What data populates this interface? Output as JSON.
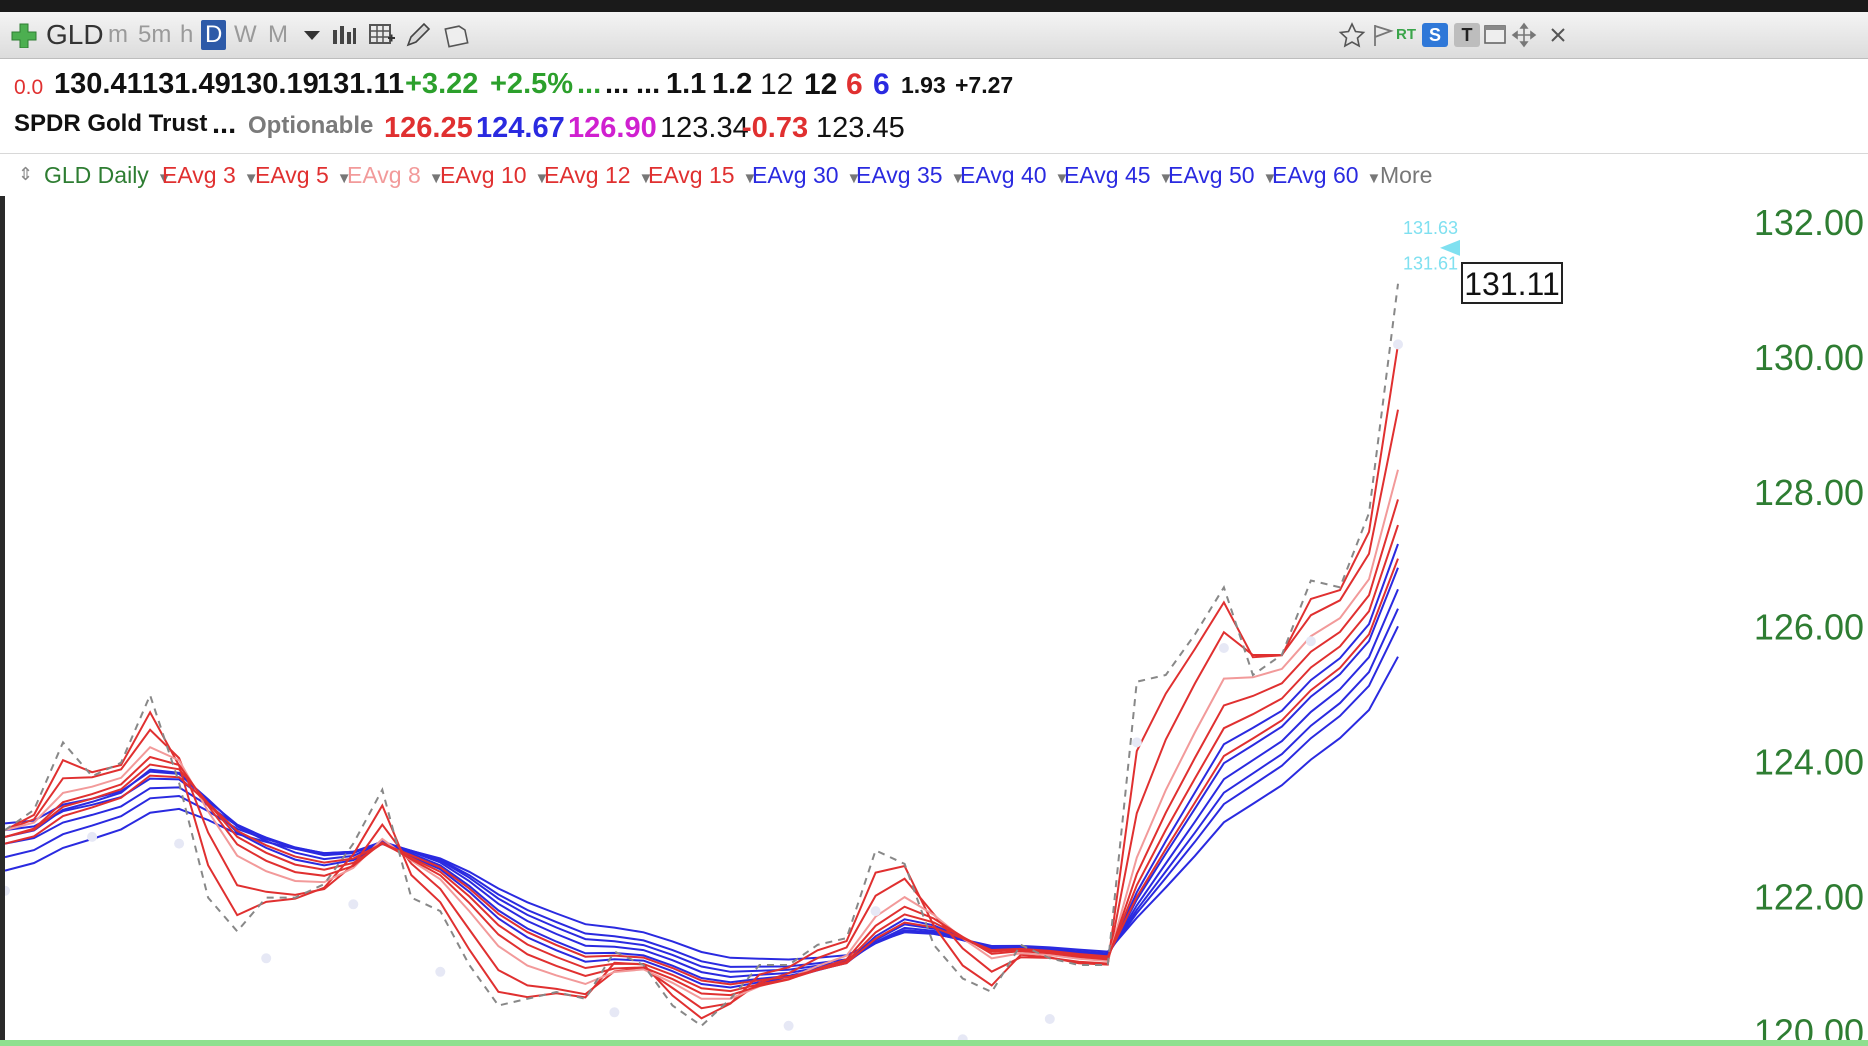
{
  "toolbar": {
    "symbol": "GLD",
    "periods": [
      "m",
      "5m",
      "h",
      "D",
      "W",
      "M"
    ],
    "selected_period": "D",
    "rt_label": "RT",
    "s_label": "S",
    "t_label": "T"
  },
  "quote": {
    "change_small": "0.0",
    "open": "130.41",
    "high": "131.49",
    "low": "130.19",
    "close": "131.11",
    "change": "+3.22",
    "change_pct": "+2.5%",
    "dots1": "...",
    "dots2": "...",
    "dots3": "...",
    "v1": "1.1",
    "v2": "1.2",
    "v3": "12",
    "v4": "12",
    "v5": "6",
    "v6": "6",
    "v7": "1.93",
    "v8": "+7.27",
    "name": "SPDR Gold Trust",
    "dots4": "...",
    "optionable": "Optionable",
    "p1": "126.25",
    "p2": "124.67",
    "p3": "126.90",
    "p4": "123.34",
    "p5": "-0.73",
    "p6": "123.45"
  },
  "studies": {
    "main": "GLD Daily",
    "items": [
      "EAvg 3",
      "EAvg 5",
      "EAvg 8",
      "EAvg 10",
      "EAvg 12",
      "EAvg 15",
      "EAvg 30",
      "EAvg 35",
      "EAvg 40",
      "EAvg 45",
      "EAvg 50",
      "EAvg 60"
    ],
    "more": "More"
  },
  "colors": {
    "up": "#2ca02c",
    "down": "#e02020",
    "short_ema": "#e03030",
    "short_ema_light": "#f29a9a",
    "long_ema": "#2a2ae0",
    "price_line": "#888888",
    "axis_text": "#2e7d32",
    "label_cyan": "#7fe0f0"
  },
  "axis": {
    "ticks": [
      "132.00",
      "130.00",
      "128.00",
      "126.00",
      "124.00",
      "122.00",
      "120.00"
    ],
    "last_price": "131.11",
    "marker_hi": "131.63",
    "marker_lo": "131.61"
  },
  "chart_data": {
    "type": "line",
    "ylim": [
      119.8,
      132.4
    ],
    "x": [
      0,
      1,
      2,
      3,
      4,
      5,
      6,
      7,
      8,
      9,
      10,
      11,
      12,
      13,
      14,
      15,
      16,
      17,
      18,
      19,
      20,
      21,
      22,
      23,
      24,
      25,
      26,
      27,
      28,
      29,
      30,
      31,
      32,
      33,
      34,
      35,
      36,
      37,
      38,
      39,
      40,
      41,
      42,
      43,
      44,
      45,
      46,
      47,
      48,
      49,
      50,
      51,
      52,
      53,
      54,
      55,
      56,
      57,
      58,
      59,
      60,
      61,
      62,
      63,
      64,
      65,
      66,
      67,
      68,
      69,
      70,
      71,
      72,
      73,
      74,
      75,
      76,
      77,
      78,
      79,
      80,
      81,
      82,
      83,
      84,
      85,
      86,
      87,
      88,
      89,
      90,
      91,
      92,
      93,
      94,
      95,
      96,
      97,
      98,
      99,
      100,
      101,
      102,
      103,
      104,
      105,
      106,
      107,
      108,
      109,
      110,
      111,
      112,
      113,
      114,
      115,
      116,
      117,
      118,
      119,
      120,
      121,
      122,
      123,
      124,
      125,
      126,
      127,
      128,
      129,
      130,
      131,
      132,
      133,
      134,
      135,
      136,
      137,
      138,
      139,
      140,
      141,
      142,
      143,
      144,
      145,
      146,
      147,
      148,
      149,
      150,
      151,
      152,
      153,
      154,
      155,
      156,
      157,
      158,
      159,
      160,
      161,
      162,
      163,
      164,
      165,
      166,
      167,
      168,
      169,
      170,
      171,
      172,
      173,
      174,
      175,
      176,
      177,
      178,
      179,
      180,
      181,
      182,
      183,
      184,
      185,
      186,
      187,
      188,
      189,
      190,
      191,
      192,
      193,
      194,
      195,
      196,
      197,
      198,
      199,
      200
    ],
    "close": [
      123.0,
      123.3,
      124.3,
      123.8,
      124.0,
      125.0,
      123.7,
      122.0,
      121.5,
      122.0,
      122.0,
      122.2,
      122.8,
      123.6,
      122.0,
      121.8,
      121.0,
      120.4,
      120.5,
      120.6,
      120.5,
      121.2,
      121.0,
      120.4,
      120.1,
      120.5,
      121.0,
      121.0,
      121.3,
      121.4,
      122.7,
      122.5,
      121.3,
      120.8,
      120.6,
      121.3,
      121.1,
      121.0,
      121.0,
      125.2,
      125.3,
      125.9,
      126.6,
      125.3,
      125.6,
      126.7,
      126.6,
      127.7,
      131.1
    ]
  }
}
